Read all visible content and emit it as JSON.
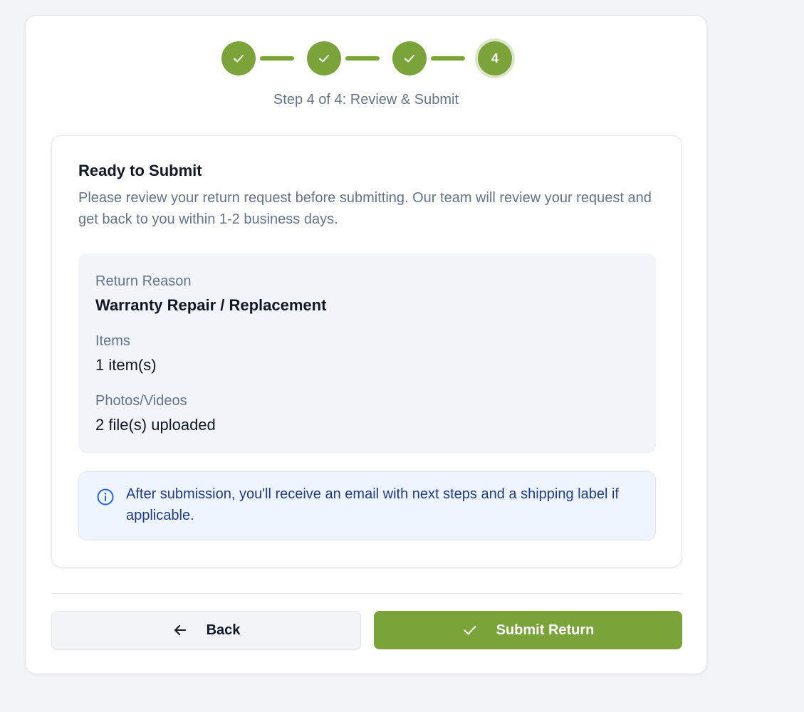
{
  "stepper": {
    "steps": [
      {
        "state": "complete",
        "icon": "check-icon"
      },
      {
        "state": "complete",
        "icon": "check-icon"
      },
      {
        "state": "complete",
        "icon": "check-icon"
      },
      {
        "state": "current",
        "number": "4"
      }
    ],
    "caption": "Step 4 of 4: Review & Submit"
  },
  "review": {
    "title": "Ready to Submit",
    "description": "Please review your return request before submitting. Our team will review your request and get back to you within 1-2 business days.",
    "summary": {
      "reason_label": "Return Reason",
      "reason_value": "Warranty Repair / Replacement",
      "items_label": "Items",
      "items_value": "1 item(s)",
      "media_label": "Photos/Videos",
      "media_value": "2 file(s) uploaded"
    },
    "notice": {
      "icon": "info-icon",
      "text": "After submission, you'll receive an email with next steps and a shipping label if applicable."
    }
  },
  "actions": {
    "back_label": "Back",
    "back_icon": "arrow-left-icon",
    "submit_label": "Submit Return",
    "submit_icon": "check-icon"
  },
  "colors": {
    "accent": "#7aa33a",
    "info_bg": "#eef5fe",
    "info_text": "#1e3a8a"
  }
}
